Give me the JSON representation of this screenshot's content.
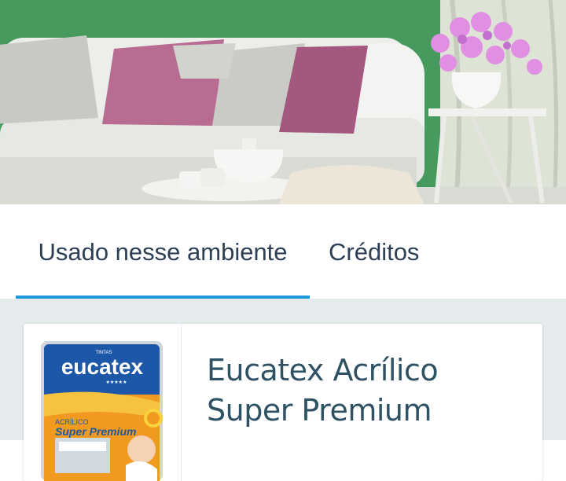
{
  "hero": {
    "icon": "room-photo"
  },
  "tabs": [
    {
      "label": "Usado nesse ambiente",
      "active": true
    },
    {
      "label": "Créditos",
      "active": false
    }
  ],
  "colors": {
    "accent": "#1e97dd",
    "tab_text": "#2c3f55",
    "title_text": "#2f5164",
    "content_bg": "#e5eaed"
  },
  "product": {
    "name": "Eucatex Acrílico Super Premium",
    "image": {
      "brand_top": "TINTAS",
      "brand": "eucatex",
      "stars": "★★★★★",
      "line": "ACRÍLICO",
      "sub": "Super Premium"
    }
  }
}
